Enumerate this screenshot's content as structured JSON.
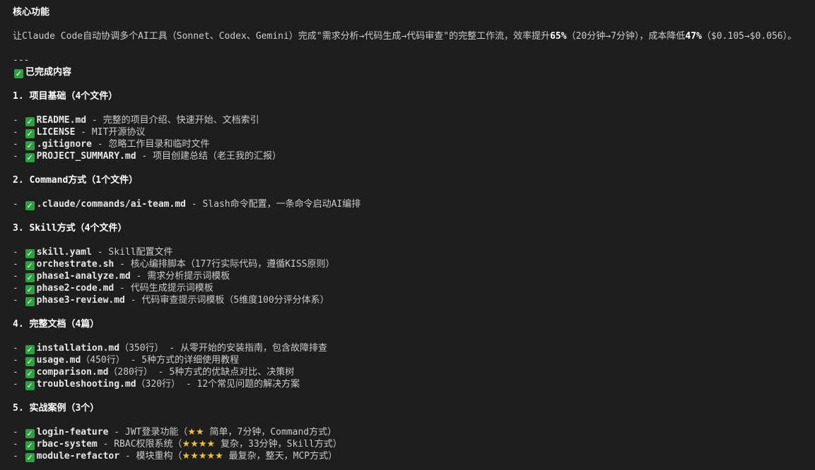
{
  "title": "核心功能",
  "intro": {
    "p1": "让Claude Code自动协调多个AI工具（Sonnet、Codex、Gemini）完成\"需求分析→代码生成→代码审查\"的完整工作流，效率提升",
    "b1": "65%",
    "p2": "（20分钟→7分钟），成本降低",
    "b2": "47%",
    "p3": "（$0.105→$0.056）。"
  },
  "separator": "---",
  "done_title": "已完成内容",
  "sections": [
    {
      "heading": "1. 项目基础（4个文件）",
      "items": [
        {
          "file": "README.md",
          "desc": " - 完整的项目介绍、快速开始、文档索引"
        },
        {
          "file": "LICENSE",
          "desc": " - MIT开源协议"
        },
        {
          "file": ".gitignore",
          "desc": " - 忽略工作目录和临时文件"
        },
        {
          "file": "PROJECT_SUMMARY.md",
          "desc": " - 项目创建总结（老王我的汇报）"
        }
      ]
    },
    {
      "heading": "2. Command方式（1个文件）",
      "items": [
        {
          "file": ".claude/commands/ai-team.md",
          "desc": " - Slash命令配置，一条命令启动AI编排"
        }
      ]
    },
    {
      "heading": "3. Skill方式（4个文件）",
      "items": [
        {
          "file": "skill.yaml",
          "desc": " - Skill配置文件"
        },
        {
          "file": "orchestrate.sh",
          "desc": " - 核心编排脚本（177行实际代码，遵循KISS原则）"
        },
        {
          "file": "phase1-analyze.md",
          "desc": " - 需求分析提示词模板"
        },
        {
          "file": "phase2-code.md",
          "desc": " - 代码生成提示词模板"
        },
        {
          "file": "phase3-review.md",
          "desc": " - 代码审查提示词模板（5维度100分评分体系）"
        }
      ]
    },
    {
      "heading": "4. 完整文档（4篇）",
      "items": [
        {
          "file": "installation.md",
          "desc": "（350行） - 从零开始的安装指南，包含故障排查"
        },
        {
          "file": "usage.md",
          "desc": "（450行） - 5种方式的详细使用教程"
        },
        {
          "file": "comparison.md",
          "desc": "（280行） - 5种方式的优缺点对比、决策树"
        },
        {
          "file": "troubleshooting.md",
          "desc": "（320行） - 12个常见问题的解决方案"
        }
      ]
    },
    {
      "heading": "5. 实战案例（3个）",
      "items": [
        {
          "file": "login-feature",
          "pre": " - JWT登录功能（",
          "stars": "★★",
          "desc": " 简单，7分钟，Command方式）"
        },
        {
          "file": "rbac-system",
          "pre": " - RBAC权限系统（",
          "stars": "★★★★",
          "desc": " 复杂，33分钟，Skill方式）"
        },
        {
          "file": "module-refactor",
          "pre": " - 模块重构（",
          "stars": "★★★★★",
          "desc": " 最复杂，整天，MCP方式）"
        }
      ]
    }
  ],
  "bullet": "-",
  "icons": {
    "check": "check-mark-button-icon",
    "stars": "star-icon"
  },
  "colors": {
    "background": "#1e1e1e",
    "text": "#cccccc",
    "check": "#2ea043",
    "star": "#f2c037"
  }
}
